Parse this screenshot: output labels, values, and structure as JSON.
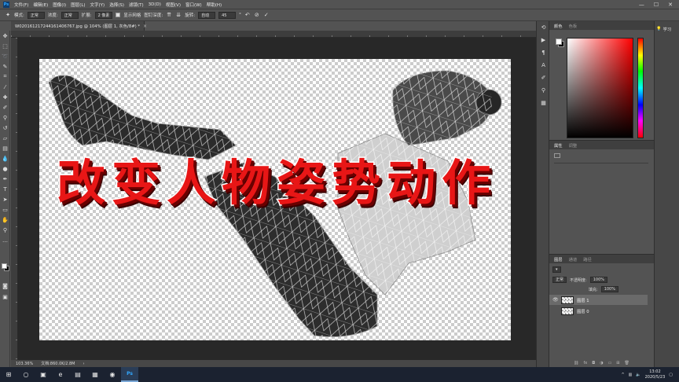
{
  "menubar": {
    "items": [
      "文件(F)",
      "编辑(E)",
      "图像(I)",
      "图层(L)",
      "文字(Y)",
      "选择(S)",
      "滤镜(T)",
      "3D(D)",
      "视图(V)",
      "窗口(W)",
      "帮助(H)"
    ]
  },
  "optbar": {
    "mode_label": "模式:",
    "mode_value": "正常",
    "density_label": "浓度:",
    "density_value": "正常",
    "expand_label": "扩展:",
    "expand_value": "2 像素",
    "show_mesh_label": "显示网格",
    "pin_depth_label": "图钉深度:",
    "rotate_label": "旋转:",
    "rotate_value": "自动",
    "rotate_degrees": "45"
  },
  "document": {
    "tab_title": "W020161217244161406767.jpg @ 104% (图层 1, 灰色/8#) *"
  },
  "overlay": {
    "chars": [
      "改",
      "变",
      "人",
      "物",
      "姿",
      "势",
      "动",
      "作"
    ]
  },
  "statusbar": {
    "zoom": "103.36%",
    "doc_info": "文档:860.0K/2.8M"
  },
  "color_panel": {
    "tab_color": "颜色",
    "tab_swatches": "色板"
  },
  "properties_panel": {
    "tab_properties": "属性",
    "tab_adjustments": "调整"
  },
  "layers_panel": {
    "tab_layers": "图层",
    "tab_channels": "通道",
    "tab_paths": "路径",
    "blend_mode": "正常",
    "opacity_label": "不透明度:",
    "opacity_value": "100%",
    "fill_label": "填充:",
    "fill_value": "100%",
    "layers": [
      {
        "name": "图层 1"
      },
      {
        "name": "图层 0"
      }
    ]
  },
  "learn": {
    "label": "学习"
  },
  "tray": {
    "time": "13:02",
    "date": "2020/5/23"
  },
  "colors": {
    "app_bg": "#535353",
    "canvas_bg": "#282828",
    "title_red": "#e81616"
  }
}
